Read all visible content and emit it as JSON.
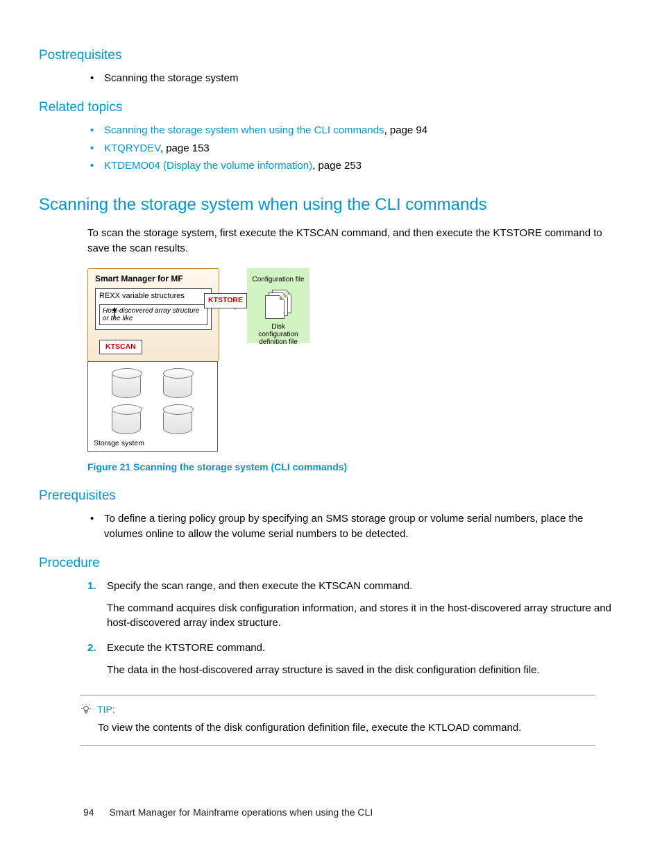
{
  "postreq": {
    "heading": "Postrequisites",
    "items": [
      "Scanning the storage system"
    ]
  },
  "related": {
    "heading": "Related topics",
    "items": [
      {
        "link": "Scanning the storage system when using the CLI commands",
        "suffix": ", page 94"
      },
      {
        "link": "KTQRYDEV",
        "suffix": ", page 153"
      },
      {
        "link": "KTDEMO04 (Display the volume information)",
        "suffix": ", page 253"
      }
    ]
  },
  "section": {
    "heading": "Scanning the storage system when using the CLI commands",
    "intro": "To scan the storage system, first execute the KTSCAN command, and then execute the KTSTORE command to save the scan results."
  },
  "diagram": {
    "smart_title": "Smart Manager for MF",
    "rexx_label": "REXX variable structures",
    "hda_label": "Host-discovered array structure or the like",
    "ktscan": "KTSCAN",
    "ktstore": "KTSTORE",
    "cfg_label": "Configuration file",
    "dcd_label": "Disk configuration definition file",
    "storage_label": "Storage system"
  },
  "figure_caption": "Figure 21 Scanning the storage system (CLI commands)",
  "prereq": {
    "heading": "Prerequisites",
    "items": [
      "To define a tiering policy group by specifying an SMS storage group or volume serial numbers, place the volumes online to allow the volume serial numbers to be detected."
    ]
  },
  "procedure": {
    "heading": "Procedure",
    "steps": [
      {
        "main": "Specify the scan range, and then execute the KTSCAN command.",
        "sub": "The command acquires disk configuration information, and stores it in the host-discovered array structure and host-discovered array index structure."
      },
      {
        "main": "Execute the KTSTORE command.",
        "sub": "The data in the host-discovered array structure is saved in the disk configuration definition file."
      }
    ]
  },
  "tip": {
    "label": "TIP:",
    "body": "To view the contents of the disk configuration definition file, execute the KTLOAD command."
  },
  "footer": {
    "page": "94",
    "chapter": "Smart Manager for Mainframe operations when using the CLI"
  }
}
